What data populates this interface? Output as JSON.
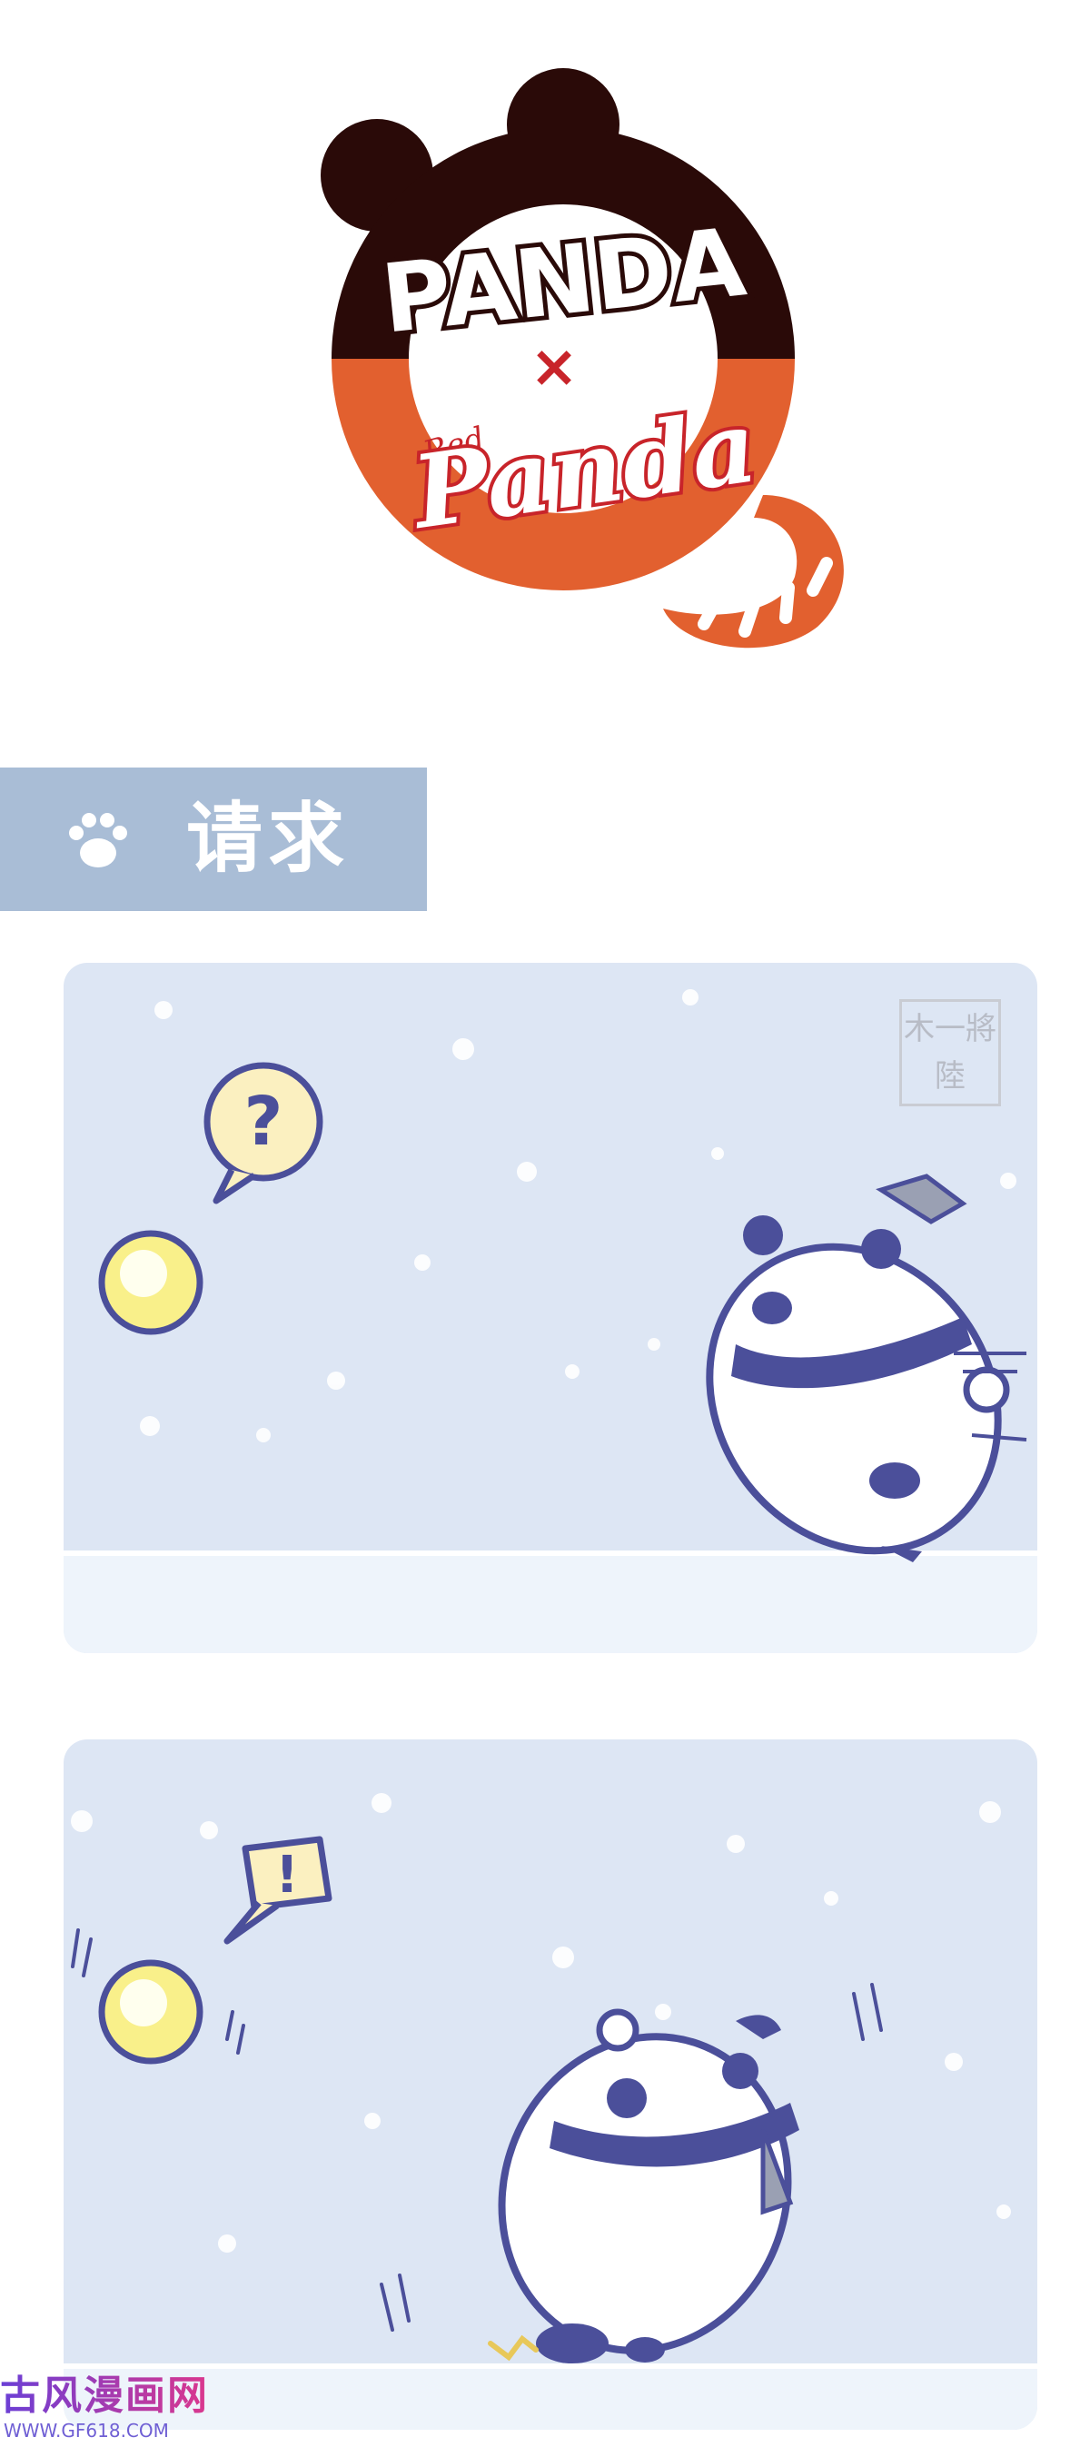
{
  "logo": {
    "line1": "PANDA",
    "separator": "×",
    "small": "Red",
    "line2": "Panda",
    "colors": {
      "dark": "#2a0a08",
      "orange": "#e2602f",
      "accent": "#c8242a"
    }
  },
  "episode": {
    "title": "请求",
    "icon": "paw-icon"
  },
  "panels": [
    {
      "speech": "?",
      "seal": "木一將陸"
    },
    {
      "speech": "!"
    }
  ],
  "watermark": {
    "site": "古风漫画网",
    "url": "WWW.GF618.COM"
  },
  "colors": {
    "banner": "#a9bdd6",
    "panel_bg": "#dde6f4",
    "ink": "#4b4f9a",
    "ball": "#f9f08a"
  }
}
